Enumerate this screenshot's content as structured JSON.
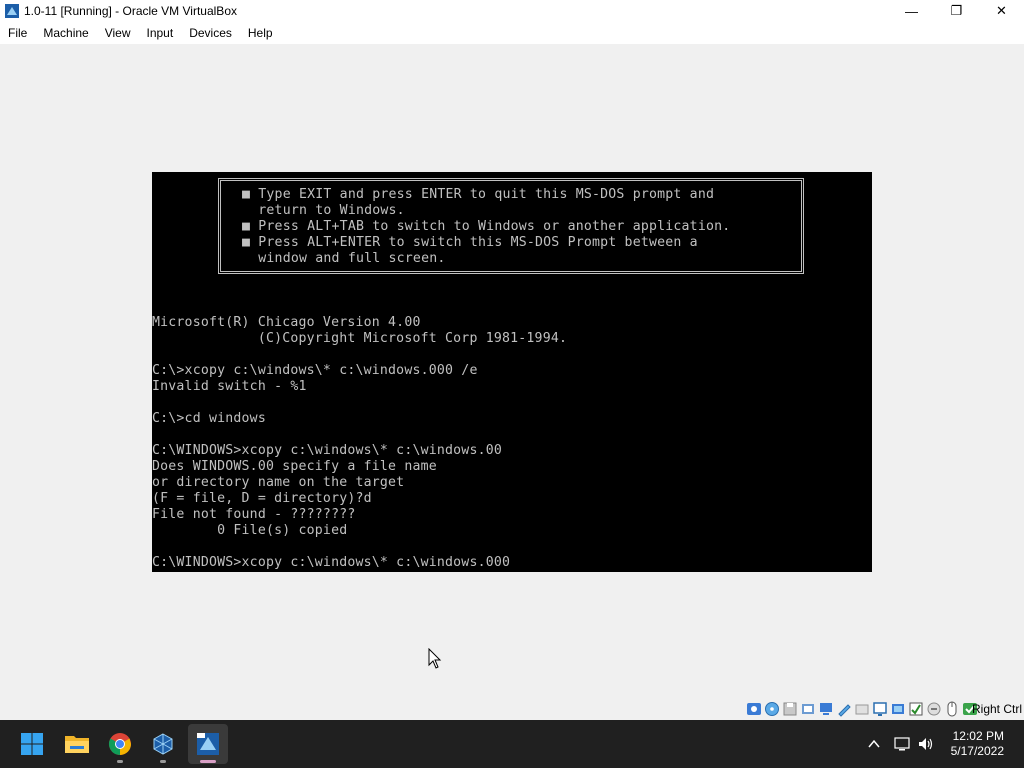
{
  "window": {
    "title": "1.0-11 [Running] - Oracle VM VirtualBox",
    "controls": {
      "minimize": "—",
      "restore": "❐",
      "close": "✕"
    }
  },
  "menu": [
    "File",
    "Machine",
    "View",
    "Input",
    "Devices",
    "Help"
  ],
  "dos": {
    "box_lines": [
      "■ Type EXIT and press ENTER to quit this MS-DOS prompt and",
      "  return to Windows.",
      "■ Press ALT+TAB to switch to Windows or another application.",
      "■ Press ALT+ENTER to switch this MS-DOS Prompt between a",
      "  window and full screen."
    ],
    "lines": [
      "Microsoft(R) Chicago Version 4.00",
      "             (C)Copyright Microsoft Corp 1981-1994.",
      "",
      "C:\\>xcopy c:\\windows\\* c:\\windows.000 /e",
      "Invalid switch - %1",
      "",
      "C:\\>cd windows",
      "",
      "C:\\WINDOWS>xcopy c:\\windows\\* c:\\windows.00",
      "Does WINDOWS.00 specify a file name",
      "or directory name on the target",
      "(F = file, D = directory)?d",
      "File not found - ????????",
      "        0 File(s) copied",
      "",
      "C:\\WINDOWS>xcopy c:\\windows\\* c:\\windows.000"
    ]
  },
  "statusbar": {
    "icons": [
      "hard-disk-icon",
      "optical-drive-icon",
      "floppy-icon",
      "audio-icon",
      "network-icon",
      "usb-icon",
      "shared-folder-icon",
      "display-icon",
      "recording-icon",
      "cpu-icon",
      "virtualization-icon",
      "mouse-integration-icon",
      "host-key-icon"
    ],
    "host_key": "Right Ctrl"
  },
  "taskbar": {
    "apps": [
      "start-button",
      "file-explorer",
      "chrome",
      "virtualbox",
      "virtualbox-vm-window"
    ],
    "clock": {
      "time": "12:02 PM",
      "date": "5/17/2022"
    }
  },
  "colors": {
    "dos_text": "#c0c0c0",
    "dos_bg": "#000000",
    "taskbar": "#202020"
  }
}
